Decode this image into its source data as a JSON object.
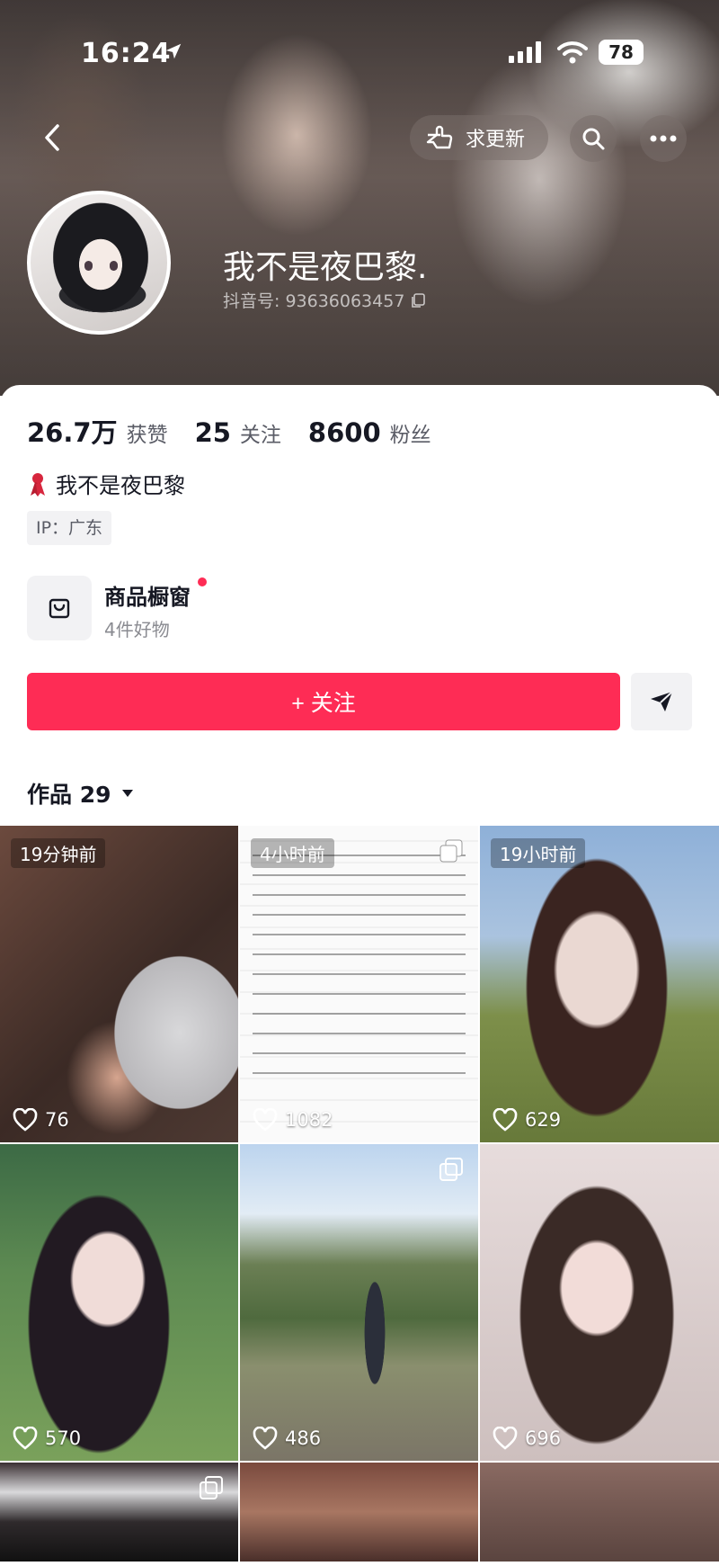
{
  "status_bar": {
    "time": "16:24",
    "battery": "78"
  },
  "nav": {
    "request_update_label": "求更新"
  },
  "profile": {
    "name": "我不是夜巴黎.",
    "douyin_id": "抖音号: 93636063457",
    "bio": "我不是夜巴黎",
    "ip": "IP：广东"
  },
  "stats": [
    {
      "value": "26.7万",
      "label": "获赞"
    },
    {
      "value": "25",
      "label": "关注"
    },
    {
      "value": "8600",
      "label": "粉丝"
    }
  ],
  "shop": {
    "title": "商品橱窗",
    "subtitle": "4件好物"
  },
  "actions": {
    "follow_label": "+ 关注"
  },
  "works": {
    "tab_label": "作品 29"
  },
  "colors": {
    "accent": "#fe2c55",
    "text": "#161823"
  },
  "grid": [
    {
      "time": "19分钟前",
      "likes": "76"
    },
    {
      "time": "4小时前",
      "likes": "1082"
    },
    {
      "time": "19小时前",
      "likes": "629"
    },
    {
      "time": "",
      "likes": "570"
    },
    {
      "time": "",
      "likes": "486"
    },
    {
      "time": "",
      "likes": "696"
    }
  ]
}
